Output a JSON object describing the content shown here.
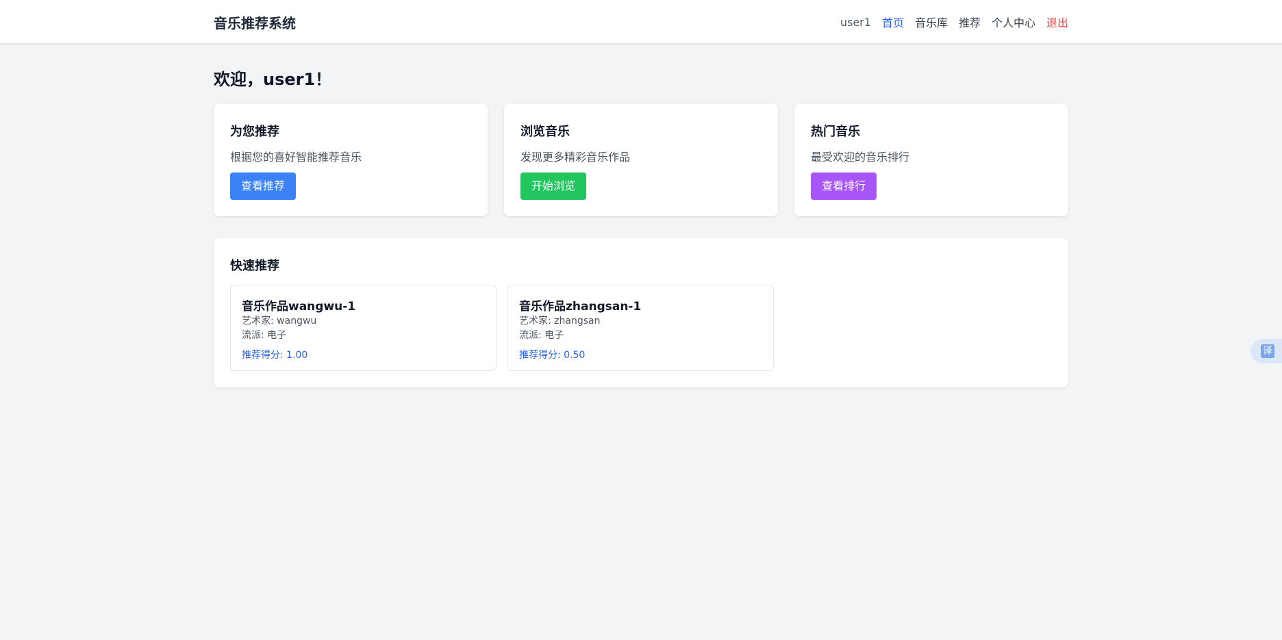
{
  "navbar": {
    "brand": "音乐推荐系统",
    "user": "user1",
    "links": {
      "home": "首页",
      "library": "音乐库",
      "recommend": "推荐",
      "profile": "个人中心",
      "logout": "退出"
    }
  },
  "welcome": "欢迎，user1！",
  "cards": [
    {
      "title": "为您推荐",
      "desc": "根据您的喜好智能推荐音乐",
      "button": "查看推荐",
      "color": "#3b82f6"
    },
    {
      "title": "浏览音乐",
      "desc": "发现更多精彩音乐作品",
      "button": "开始浏览",
      "color": "#22c55e"
    },
    {
      "title": "热门音乐",
      "desc": "最受欢迎的音乐排行",
      "button": "查看排行",
      "color": "#a855f7"
    }
  ],
  "quick": {
    "title": "快速推荐",
    "songs": [
      {
        "title": "音乐作品wangwu-1",
        "artist": "艺术家: wangwu",
        "genre": "流派: 电子",
        "score": "推荐得分: 1.00"
      },
      {
        "title": "音乐作品zhangsan-1",
        "artist": "艺术家: zhangsan",
        "genre": "流派: 电子",
        "score": "推荐得分: 0.50"
      }
    ]
  },
  "translate": {
    "label": "译",
    "icon": "translate-icon"
  },
  "colors": {
    "accent": "#2563eb",
    "logout": "#ef4444",
    "background": "#f3f4f6"
  }
}
